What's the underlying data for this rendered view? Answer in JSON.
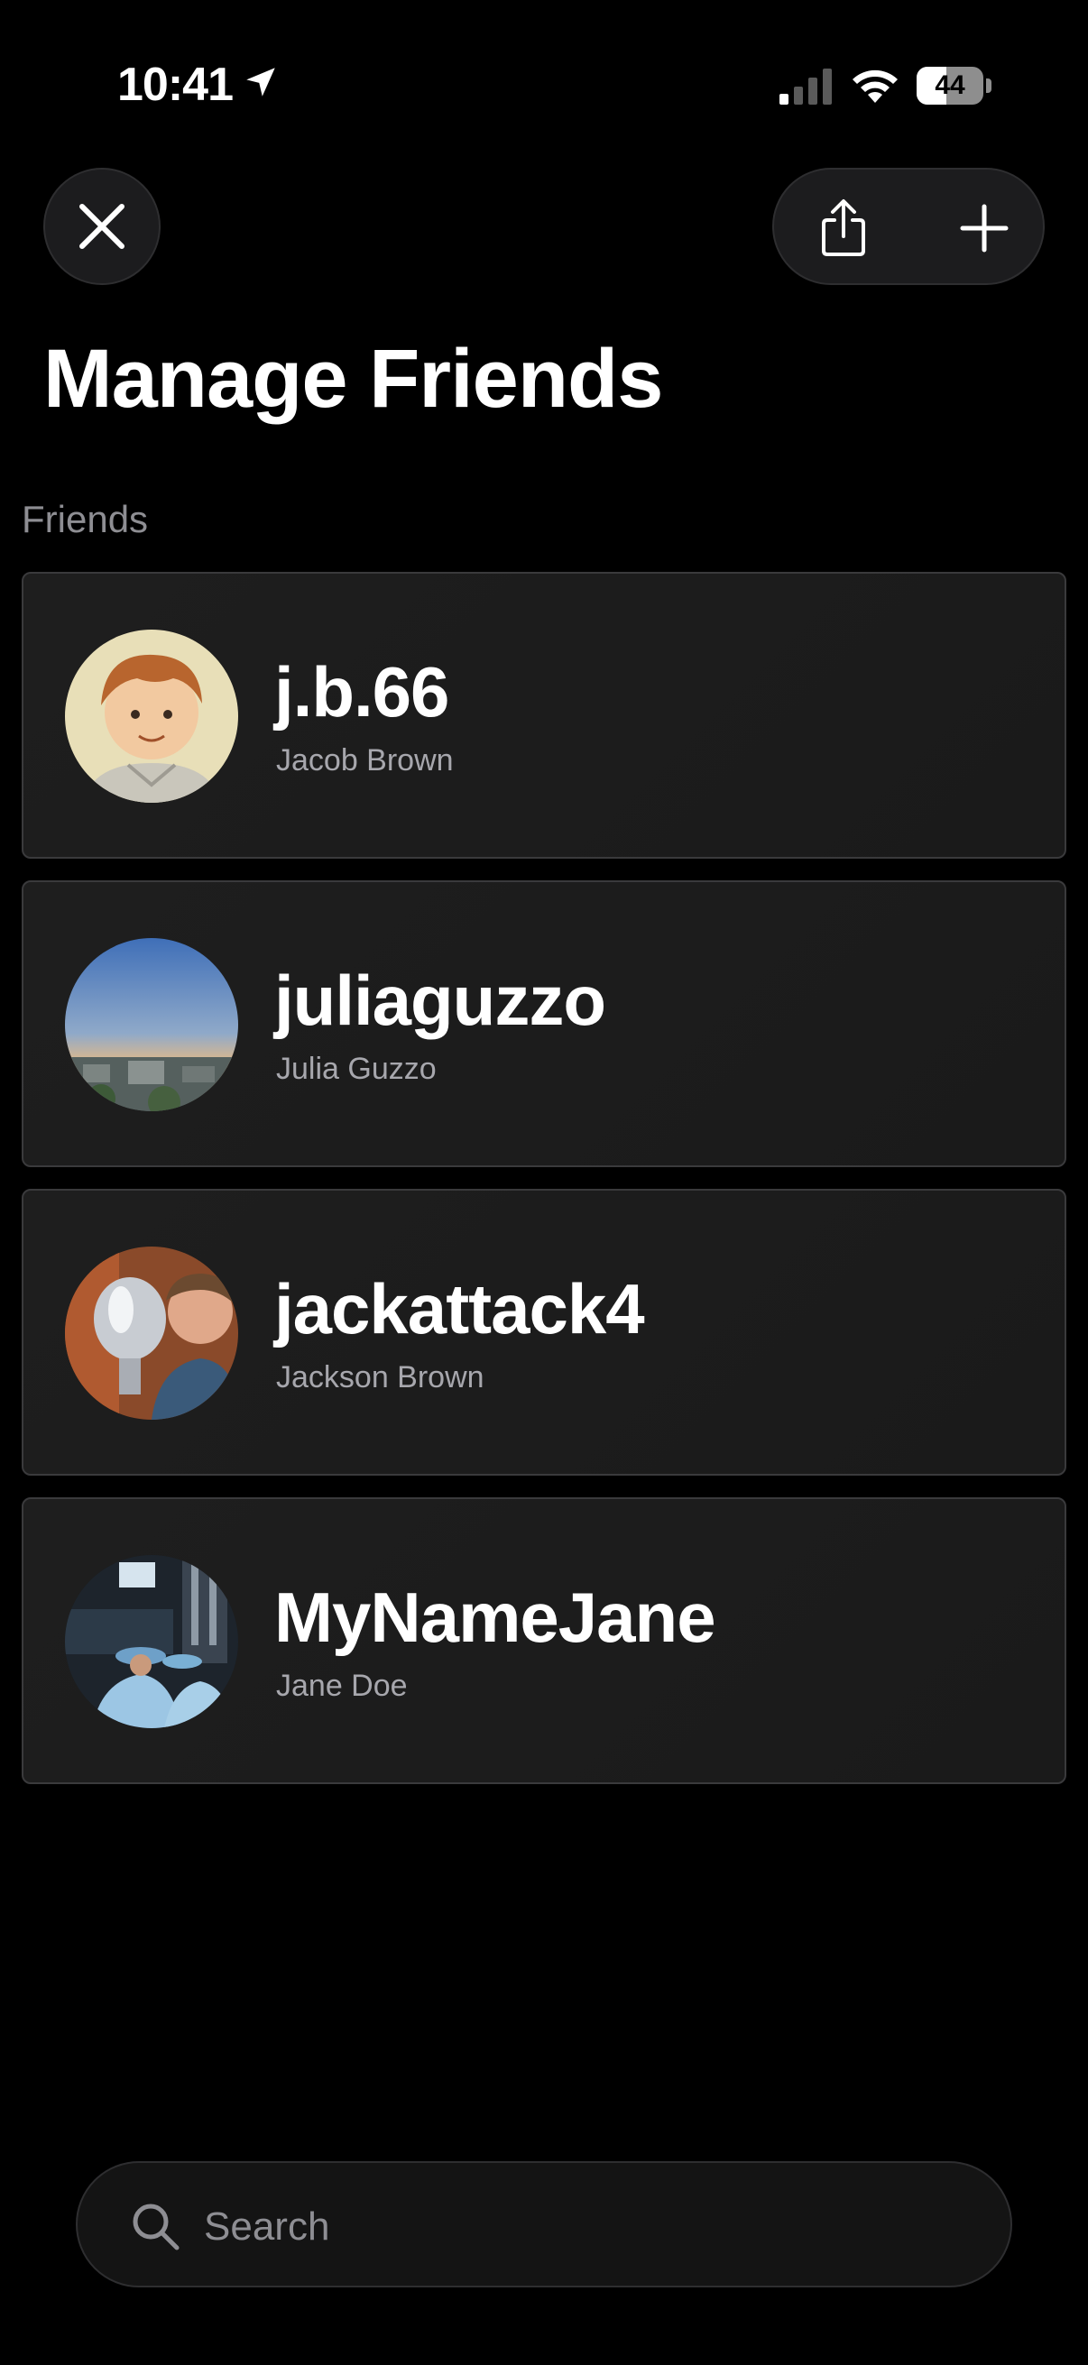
{
  "status_bar": {
    "time": "10:41",
    "battery_level": "44",
    "battery_fraction": 0.44
  },
  "header": {
    "close_icon": "close-icon",
    "share_icon": "share-icon",
    "add_icon": "plus-icon",
    "title": "Manage Friends"
  },
  "friends_section": {
    "label": "Friends",
    "items": [
      {
        "username": "j.b.66",
        "name": "Jacob Brown",
        "avatar": "cartoon-portrait"
      },
      {
        "username": "juliaguzzo",
        "name": "Julia Guzzo",
        "avatar": "city-sunset"
      },
      {
        "username": "jackattack4",
        "name": "Jackson Brown",
        "avatar": "trophy-selfie"
      },
      {
        "username": "MyNameJane",
        "name": "Jane Doe",
        "avatar": "graduation"
      }
    ]
  },
  "search": {
    "placeholder": "Search",
    "value": ""
  },
  "colors": {
    "background": "#000000",
    "card": "#1c1c1c",
    "card_border": "#3a3a3c",
    "secondary_text": "#8e8e93"
  }
}
